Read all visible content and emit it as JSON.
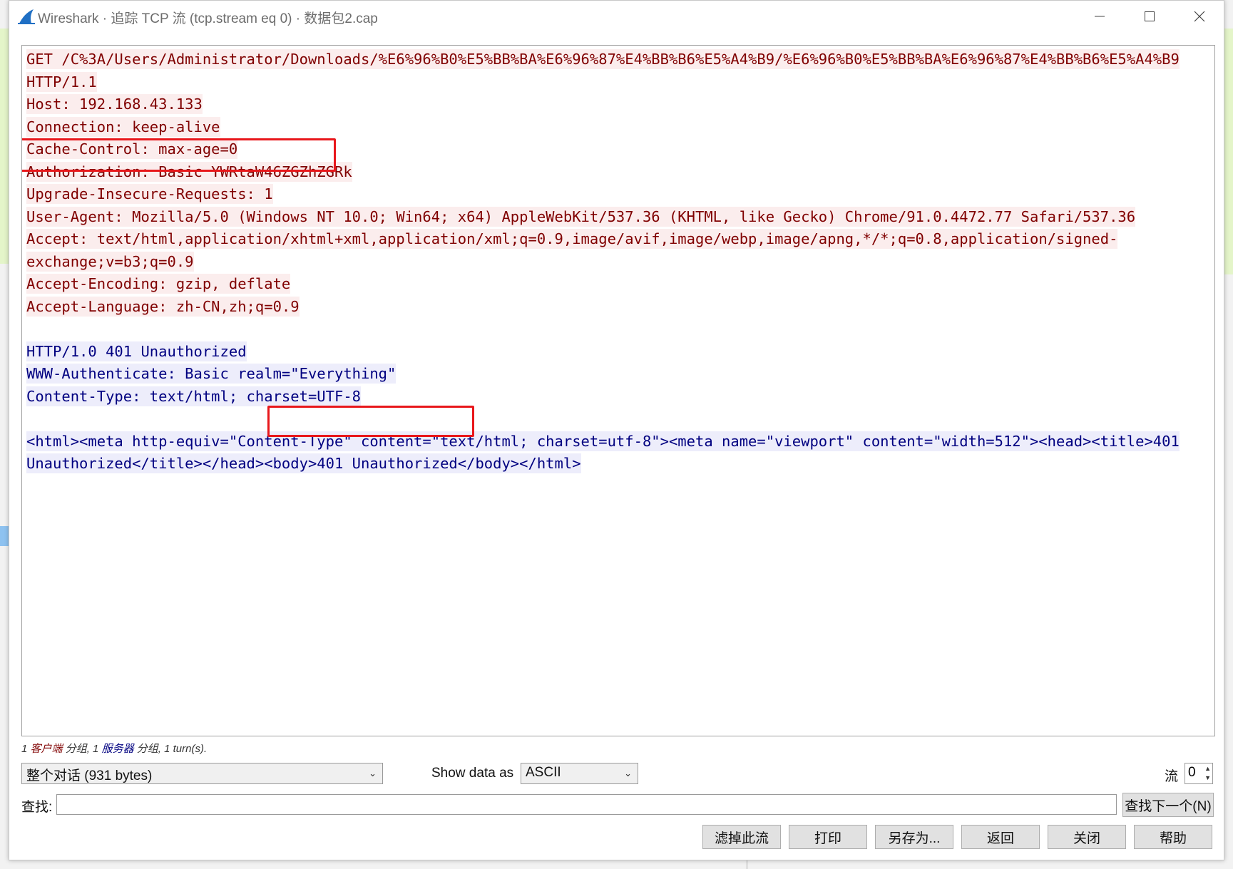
{
  "window": {
    "title": "Wireshark · 追踪 TCP 流 (tcp.stream eq 0) · 数据包2.cap"
  },
  "stream": {
    "client_lines": [
      "GET /C%3A/Users/Administrator/Downloads/%E6%96%B0%E5%BB%BA%E6%96%87%E4%BB%B6%E5%A4%B9/%E6%96%B0%E5%BB%BA%E6%96%87%E4%BB%B6%E5%A4%B9",
      "HTTP/1.1",
      "Host: 192.168.43.133",
      "Connection: keep-alive",
      "Cache-Control: max-age=0",
      "Authorization: Basic YWRtaW46ZGZhZGRk",
      "Upgrade-Insecure-Requests: 1",
      "User-Agent: Mozilla/5.0 (Windows NT 10.0; Win64; x64) AppleWebKit/537.36 (KHTML, like Gecko) Chrome/91.0.4472.77 Safari/537.36",
      "Accept: text/html,application/xhtml+xml,application/xml;q=0.9,image/avif,image/webp,image/apng,*/*;q=0.8,application/signed-",
      "exchange;v=b3;q=0.9",
      "Accept-Encoding: gzip, deflate",
      "Accept-Language: zh-CN,zh;q=0.9"
    ],
    "server_header_lines": [
      "HTTP/1.0 401 Unauthorized",
      "WWW-Authenticate: Basic realm=\"Everything\"",
      "Content-Type: text/html; charset=UTF-8"
    ],
    "server_body_lines": [
      "<html><meta http-equiv=\"Content-Type\" content=\"text/html; charset=utf-8\"><meta name=\"viewport\" content=\"width=512\"><head><title>401",
      "Unauthorized</title></head><body>401 Unauthorized</body></html>"
    ]
  },
  "stats": {
    "client_count": "1",
    "client_word": "客户端",
    "client_suffix": "分组,",
    "server_count": "1",
    "server_word": "服务器",
    "server_suffix": "分组,",
    "turns": "1 turn(s)."
  },
  "controls": {
    "conversation_select": "整个对话 (931 bytes)",
    "show_data_label": "Show data as",
    "show_data_select": "ASCII",
    "stream_label": "流",
    "stream_value": "0",
    "find_label": "查找:",
    "find_value": "",
    "find_next_button": "查找下一个(N)"
  },
  "buttons": {
    "filter_out": "滤掉此流",
    "print": "打印",
    "save_as": "另存为...",
    "back": "返回",
    "close": "关闭",
    "help": "帮助"
  },
  "colors": {
    "client_text": "#800000",
    "client_bg": "#fbeded",
    "server_text": "#000080",
    "server_bg": "#ededfb",
    "annotation_red": "#e8171b"
  }
}
